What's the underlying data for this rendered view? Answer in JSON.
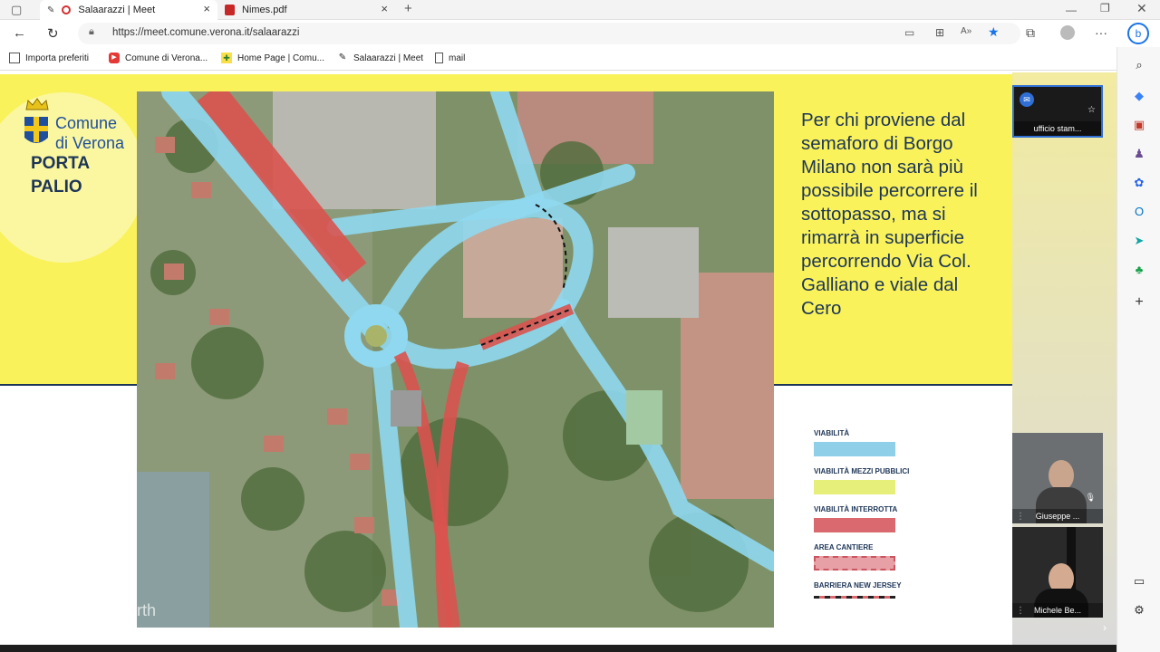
{
  "browser": {
    "tabs": [
      {
        "title": "Salaarazzi | Meet",
        "icon": "recording-icon",
        "active": true
      },
      {
        "title": "Nimes.pdf",
        "icon": "pdf-icon",
        "active": false
      }
    ],
    "url": "https://meet.comune.verona.it/salaarazzi",
    "bookmarks": [
      {
        "label": "Importa preferiti",
        "icon": "import-icon"
      },
      {
        "label": "Comune di Verona...",
        "icon": "youtube-icon"
      },
      {
        "label": "Home Page | Comu...",
        "icon": "verona-logo-icon"
      },
      {
        "label": "Salaarazzi | Meet",
        "icon": "meet-icon"
      },
      {
        "label": "mail",
        "icon": "page-icon"
      }
    ]
  },
  "slide": {
    "logo_line1": "Comune",
    "logo_line2": "di Verona",
    "heading_line1": "PORTA",
    "heading_line2": "PALIO",
    "description": "Per chi proviene dal semaforo di Borgo Milano non sarà più possibile percorrere il sottopasso, ma si rimarrà in superficie percorrendo Via Col. Galliano e viale dal Cero",
    "map_watermark": "rth",
    "legend": [
      {
        "label": "VIABILITÀ",
        "color": "#8fd0e8"
      },
      {
        "label": "VIABILITÀ MEZZI PUBBLICI",
        "color": "#e6ef7a"
      },
      {
        "label": "VIABILITÀ INTERROTTA",
        "color": "#d9696e"
      },
      {
        "label": "AREA CANTIERE",
        "color": "#e7a0a6"
      },
      {
        "label": "BARRIERA NEW JERSEY",
        "color": "#d9696e"
      }
    ]
  },
  "participants": [
    {
      "name": "ufficio stam..."
    },
    {
      "name": "Giuseppe ..."
    },
    {
      "name": "Michele Be..."
    }
  ],
  "colors": {
    "slide_yellow": "#f9f25a",
    "slide_navy": "#1d3557",
    "road_blue": "#7cc8e4",
    "road_red": "#d9534f"
  }
}
